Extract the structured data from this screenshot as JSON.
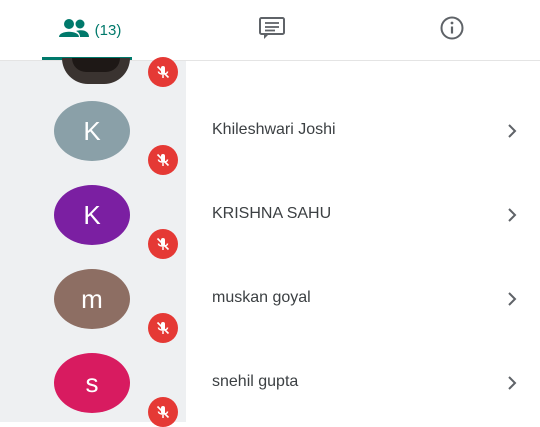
{
  "tabs": {
    "participants_count": "(13)",
    "chat_icon": "chat-icon",
    "info_icon": "info-icon",
    "accent_color": "#00796b"
  },
  "participants": [
    {
      "initial": "K",
      "name": "Khileshwari Joshi",
      "avatar_color": "#8aa0a8",
      "muted": true
    },
    {
      "initial": "K",
      "name": "KRISHNA SAHU",
      "avatar_color": "#7b1fa2",
      "muted": true
    },
    {
      "initial": "m",
      "name": "muskan goyal",
      "avatar_color": "#8d6e63",
      "muted": true
    },
    {
      "initial": "s",
      "name": "snehil gupta",
      "avatar_color": "#d81b60",
      "muted": true
    }
  ],
  "colors": {
    "mute_badge": "#e53935",
    "sidebar_bg": "#eef0f2"
  }
}
